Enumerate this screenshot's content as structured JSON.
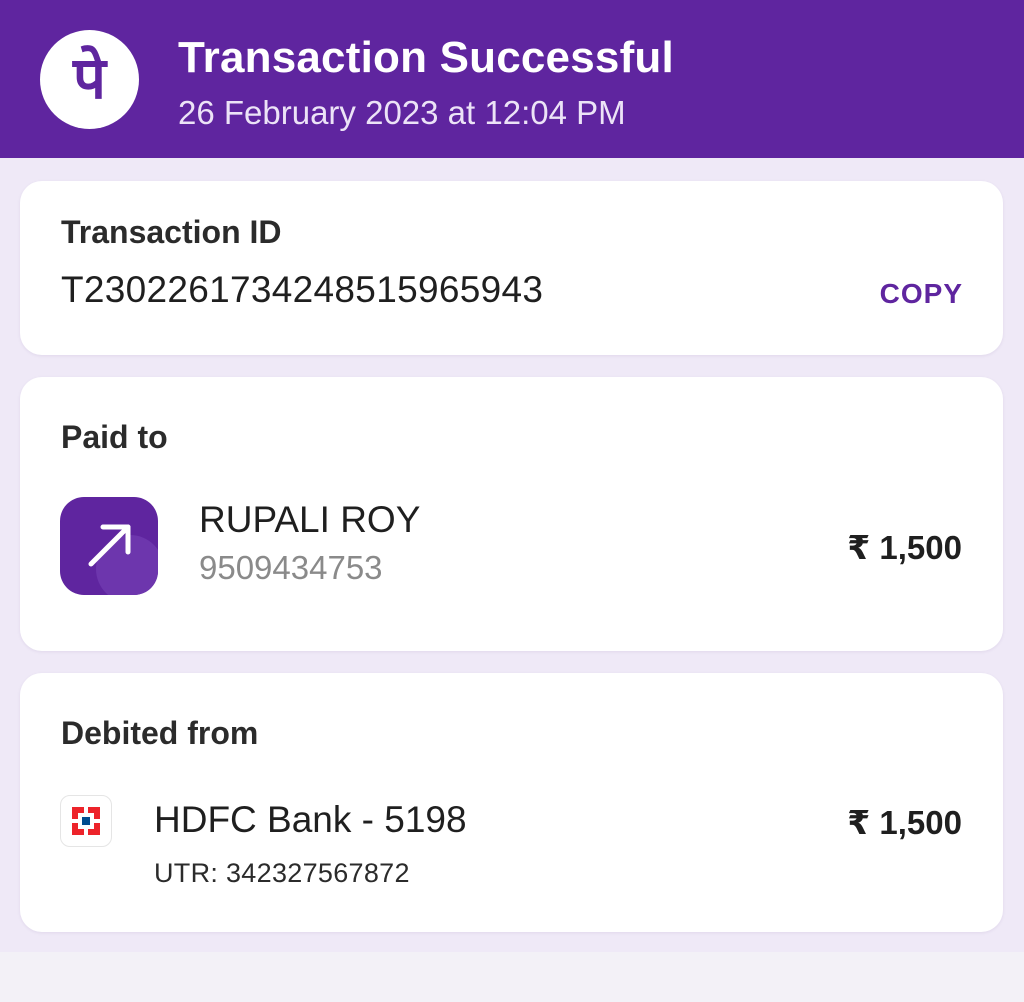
{
  "header": {
    "title": "Transaction Successful",
    "datetime": "26 February 2023 at 12:04 PM",
    "logo_icon": "phonepe-logo-icon",
    "brand_color": "#5f259f"
  },
  "transaction": {
    "label": "Transaction ID",
    "id": "T2302261734248515965943",
    "copy_label": "COPY"
  },
  "paid_to": {
    "label": "Paid to",
    "name": "RUPALI ROY",
    "phone": "9509434753",
    "amount": "₹ 1,500",
    "avatar_icon": "arrow-up-right-icon"
  },
  "debited_from": {
    "label": "Debited from",
    "account": "HDFC Bank - 5198",
    "utr": "UTR: 342327567872",
    "amount": "₹ 1,500",
    "bank_icon": "hdfc-bank-icon"
  }
}
